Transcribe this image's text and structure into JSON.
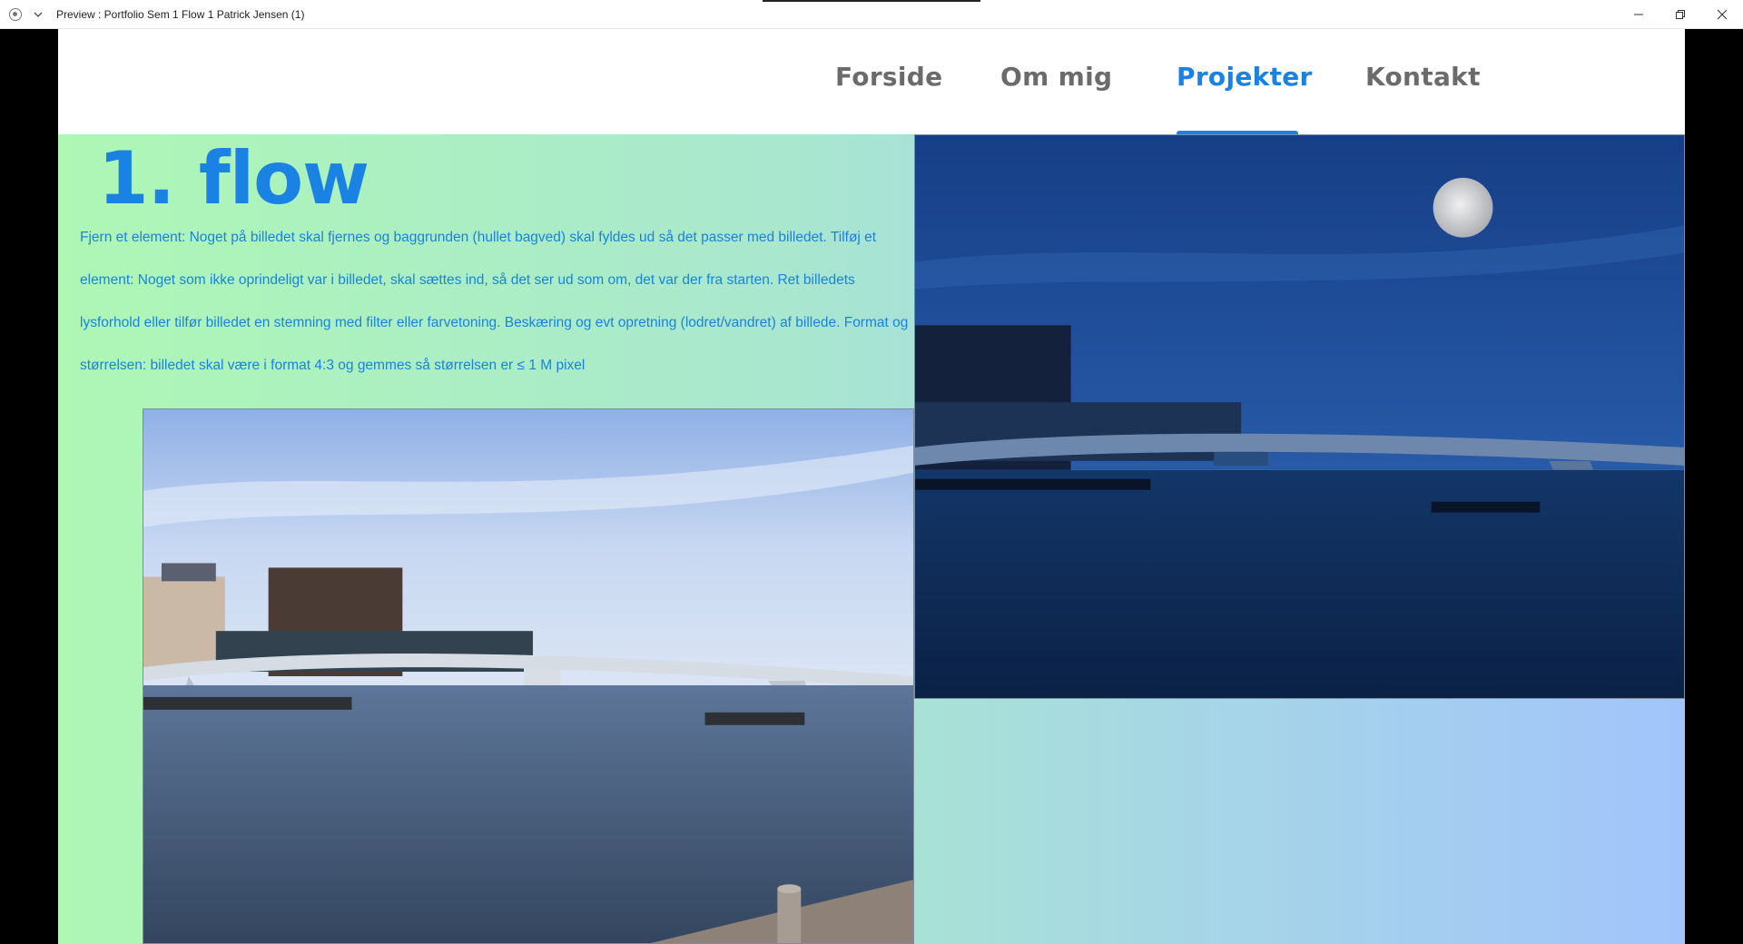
{
  "window": {
    "title": "Preview : Portfolio Sem 1 Flow 1 Patrick Jensen (1)",
    "app_icon": "radio-dot-icon",
    "menu_icon": "chevron-down-icon",
    "controls": [
      "minimize-icon",
      "restore-icon",
      "close-icon"
    ]
  },
  "nav": {
    "items": [
      {
        "label": "Forside"
      },
      {
        "label": "Om mig"
      },
      {
        "label": "Projekter"
      },
      {
        "label": "Kontakt"
      }
    ],
    "active": "Projekter",
    "colors": {
      "default": "#6b6b6b",
      "active": "#1a82e2"
    }
  },
  "project": {
    "title": "1. flow",
    "description": "Fjern et element: Noget på billedet skal fjernes og baggrunden (hullet bagved) skal fyldes ud så det passer med billedet. Tilføj et element: Noget som ikke oprindeligt var i billedet, skal sættes ind, så det ser ud som om, det var der fra starten. Ret billedets lysforhold eller tilfør billedet en stemning med filter eller farvetoning. Beskæring og evt opretning (lodret/vandret) af billede. Format og størrelsen: billedet skal være i format 4:3 og gemmes så størrelsen er ≤ 1 M pixel",
    "images": {
      "original": "harbour-bridge-daylight-photo",
      "edited": "harbour-bridge-night-moon-photo"
    }
  },
  "colors": {
    "accent": "#1a82e2",
    "gradient_start": "#aef7b5",
    "gradient_end": "#a2c4fb"
  }
}
